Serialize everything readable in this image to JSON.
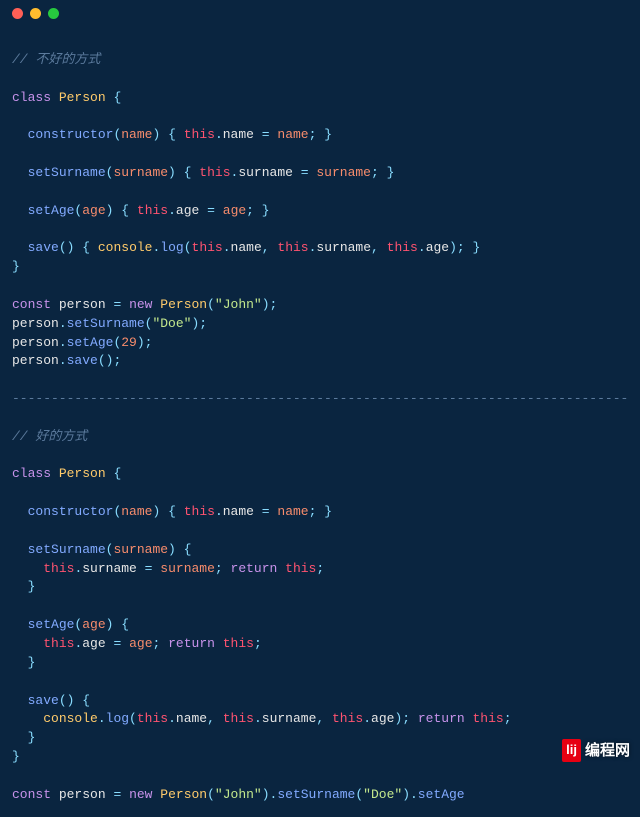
{
  "window": {
    "controls": [
      "close",
      "minimize",
      "zoom"
    ]
  },
  "code": {
    "bad_comment": "// 不好的方式",
    "good_comment": "// 好的方式",
    "class_kw": "class",
    "class_name": "Person",
    "constructor": "constructor",
    "setSurname": "setSurname",
    "setAge": "setAge",
    "save": "save",
    "name_param": "name",
    "surname_param": "surname",
    "age_param": "age",
    "this_kw": "this",
    "name_prop": "name",
    "surname_prop": "surname",
    "age_prop": "age",
    "console": "console",
    "log": "log",
    "const_kw": "const",
    "person_var": "person",
    "new_kw": "new",
    "return_kw": "return",
    "john_str": "\"John\"",
    "doe_str": "\"Doe\"",
    "age_num": "29",
    "separator": "-------------------------------------------------------------------------------"
  },
  "watermark": {
    "logo": "lij",
    "text": "编程网"
  }
}
